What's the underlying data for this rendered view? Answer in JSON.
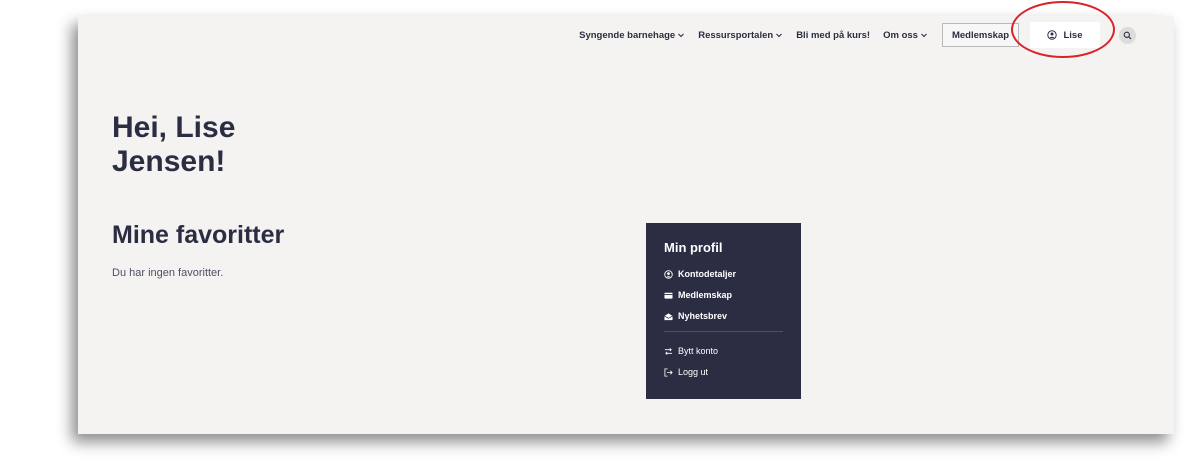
{
  "nav": {
    "items": [
      {
        "label": "Syngende barnehage",
        "has_dropdown": true
      },
      {
        "label": "Ressursportalen",
        "has_dropdown": true
      },
      {
        "label": "Bli med på kurs!",
        "has_dropdown": false
      },
      {
        "label": "Om oss",
        "has_dropdown": true
      }
    ],
    "membership_button": "Medlemskap",
    "user_button": "Lise"
  },
  "greeting": {
    "line1": "Hei, Lise",
    "line2": "Jensen!"
  },
  "favorites": {
    "title": "Mine favoritter",
    "empty_text": "Du har ingen favoritter."
  },
  "profile_menu": {
    "title": "Min profil",
    "items": [
      {
        "label": "Kontodetaljer",
        "icon": "user-circle-icon"
      },
      {
        "label": "Medlemskap",
        "icon": "card-icon"
      },
      {
        "label": "Nyhetsbrev",
        "icon": "envelope-open-icon"
      }
    ],
    "secondary_items": [
      {
        "label": "Bytt konto",
        "icon": "switch-arrows-icon"
      },
      {
        "label": "Logg ut",
        "icon": "logout-icon"
      }
    ]
  },
  "colors": {
    "brand_dark": "#2b2d42",
    "page_background": "#f4f3f1",
    "highlight": "#d9232a"
  }
}
